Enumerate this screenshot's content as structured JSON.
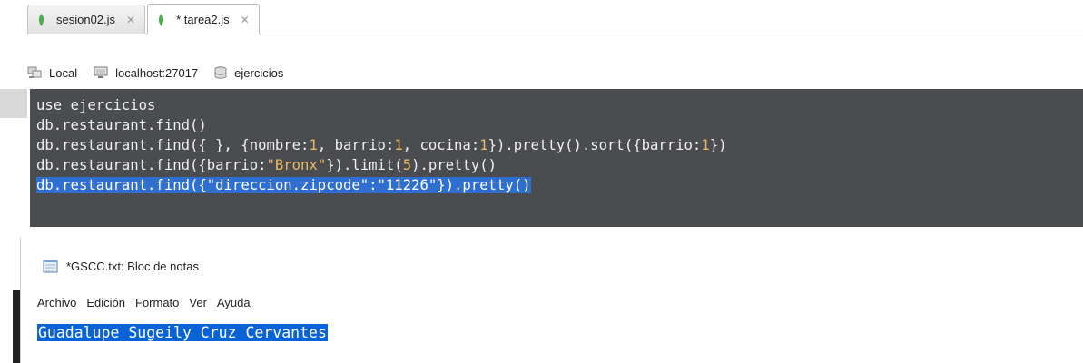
{
  "tabs": [
    {
      "label": "sesion02.js",
      "close": "✕",
      "active": false
    },
    {
      "label": "* tarea2.js",
      "close": "✕",
      "active": true
    }
  ],
  "connection": {
    "server_type": "Local",
    "host": "localhost:27017",
    "database": "ejercicios"
  },
  "editor": {
    "line1": "use ejercicios",
    "line2_a": "db.restaurant.find()",
    "line3_a": "db.restaurant.find({ }, {nombre:",
    "line3_n1": "1",
    "line3_b": ", barrio:",
    "line3_n2": "1",
    "line3_c": ", cocina:",
    "line3_n3": "1",
    "line3_d": "}).pretty().sort({barrio:",
    "line3_n4": "1",
    "line3_e": "})",
    "line4_a": "db.restaurant.find({barrio:",
    "line4_s": "\"Bronx\"",
    "line4_b": "}).limit(",
    "line4_n": "5",
    "line4_c": ").pretty()",
    "line5": "db.restaurant.find({\"direccion.zipcode\":\"11226\"}).pretty()"
  },
  "notepad": {
    "title": "*GSCC.txt: Bloc de notas",
    "menu": [
      "Archivo",
      "Edición",
      "Formato",
      "Ver",
      "Ayuda"
    ],
    "content": "Guadalupe Sugeily Cruz Cervantes"
  },
  "colors": {
    "editor_bg": "#4a4c4f",
    "selection": "#2f6fcf",
    "number_literal": "#e8b963",
    "mongo_leaf": "#4caf50"
  }
}
